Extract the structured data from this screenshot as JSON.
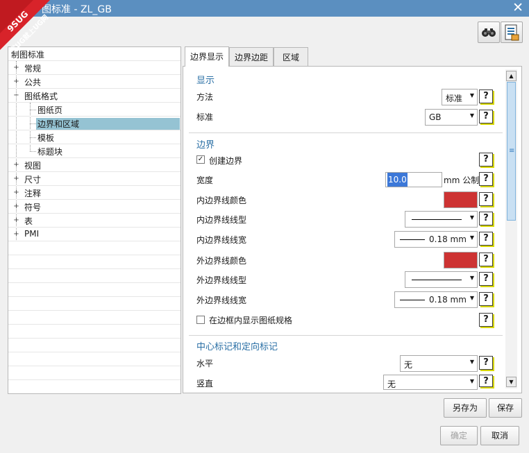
{
  "window": {
    "title": "图标准 - ZL_GB",
    "close_label": "✕",
    "logo_text_1": "9SUG",
    "logo_text_2": "学UG就上UG网"
  },
  "toolbar": {
    "binoculars": "binoculars-icon",
    "settings_file": "settings-file-icon"
  },
  "tree": {
    "root": "制图标准",
    "items": [
      {
        "label": "常规",
        "expander": "+"
      },
      {
        "label": "公共",
        "expander": "+"
      },
      {
        "label": "图纸格式",
        "expander": "−"
      },
      {
        "label": "图纸页"
      },
      {
        "label": "边界和区域"
      },
      {
        "label": "模板"
      },
      {
        "label": "标题块"
      },
      {
        "label": "视图",
        "expander": "+"
      },
      {
        "label": "尺寸",
        "expander": "+"
      },
      {
        "label": "注释",
        "expander": "+"
      },
      {
        "label": "符号",
        "expander": "+"
      },
      {
        "label": "表",
        "expander": "+"
      },
      {
        "label": "PMI",
        "expander": "+"
      }
    ]
  },
  "tabs": [
    {
      "label": "边界显示"
    },
    {
      "label": "边界边距"
    },
    {
      "label": "区域"
    }
  ],
  "display": {
    "title": "显示",
    "method_label": "方法",
    "method_value": "标准",
    "standard_label": "标准",
    "standard_value": "GB"
  },
  "border": {
    "title": "边界",
    "create_border_label": "创建边界",
    "width_label": "宽度",
    "width_value": "10.0",
    "width_unit": "mm 公制",
    "inner_color_label": "内边界线颜色",
    "inner_type_label": "内边界线线型",
    "inner_width_label": "内边界线线宽",
    "inner_width_value": "0.18 mm",
    "outer_color_label": "外边界线颜色",
    "outer_type_label": "外边界线线型",
    "outer_width_label": "外边界线线宽",
    "outer_width_value": "0.18 mm",
    "show_size_label": "在边框内显示图纸规格"
  },
  "center_marks": {
    "title": "中心标记和定向标记",
    "horizontal_label": "水平",
    "horizontal_value": "无",
    "vertical_label": "竖直",
    "vertical_value": "无"
  },
  "help_glyph": "?",
  "colors": {
    "border_line_color": "#cd3333",
    "accent": "#2a6fa5",
    "selection": "#95c3d3"
  },
  "buttons": {
    "save_as": "另存为",
    "save": "保存",
    "ok": "确定",
    "cancel": "取消"
  }
}
